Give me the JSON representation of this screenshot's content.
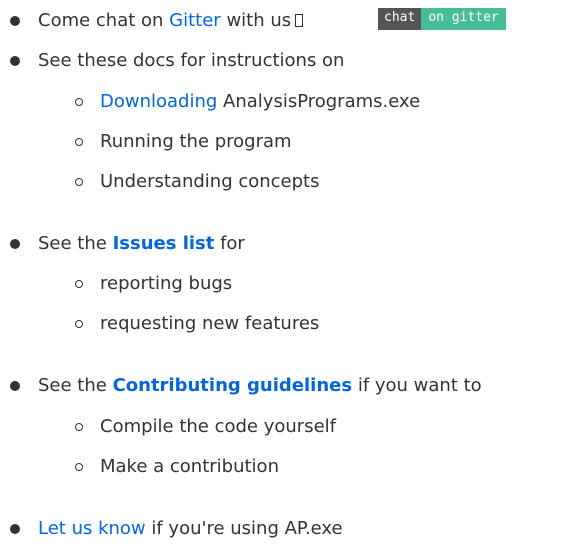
{
  "list": [
    {
      "prefix": "Come chat on ",
      "link": "Gitter",
      "suffix": " with us",
      "badge": {
        "left": "chat",
        "right": "on gitter",
        "left_color": "#555555",
        "right_color": "#46bc99"
      }
    },
    {
      "text": "See these docs for instructions on",
      "children": [
        {
          "link": "Downloading",
          "suffix": " AnalysisPrograms.exe"
        },
        {
          "text": "Running the program"
        },
        {
          "text": "Understanding concepts"
        }
      ]
    },
    {
      "prefix": "See the ",
      "link": "Issues list",
      "suffix": " for",
      "children": [
        {
          "text": "reporting bugs"
        },
        {
          "text": "requesting new features"
        }
      ]
    },
    {
      "prefix": "See the ",
      "link": "Contributing guidelines",
      "suffix": " if you want to",
      "children": [
        {
          "text": "Compile the code yourself"
        },
        {
          "text": "Make a contribution"
        }
      ]
    },
    {
      "link": "Let us know",
      "suffix": " if you're using AP.exe"
    }
  ],
  "colors": {
    "text": "#333333",
    "link": "#0366d6"
  }
}
